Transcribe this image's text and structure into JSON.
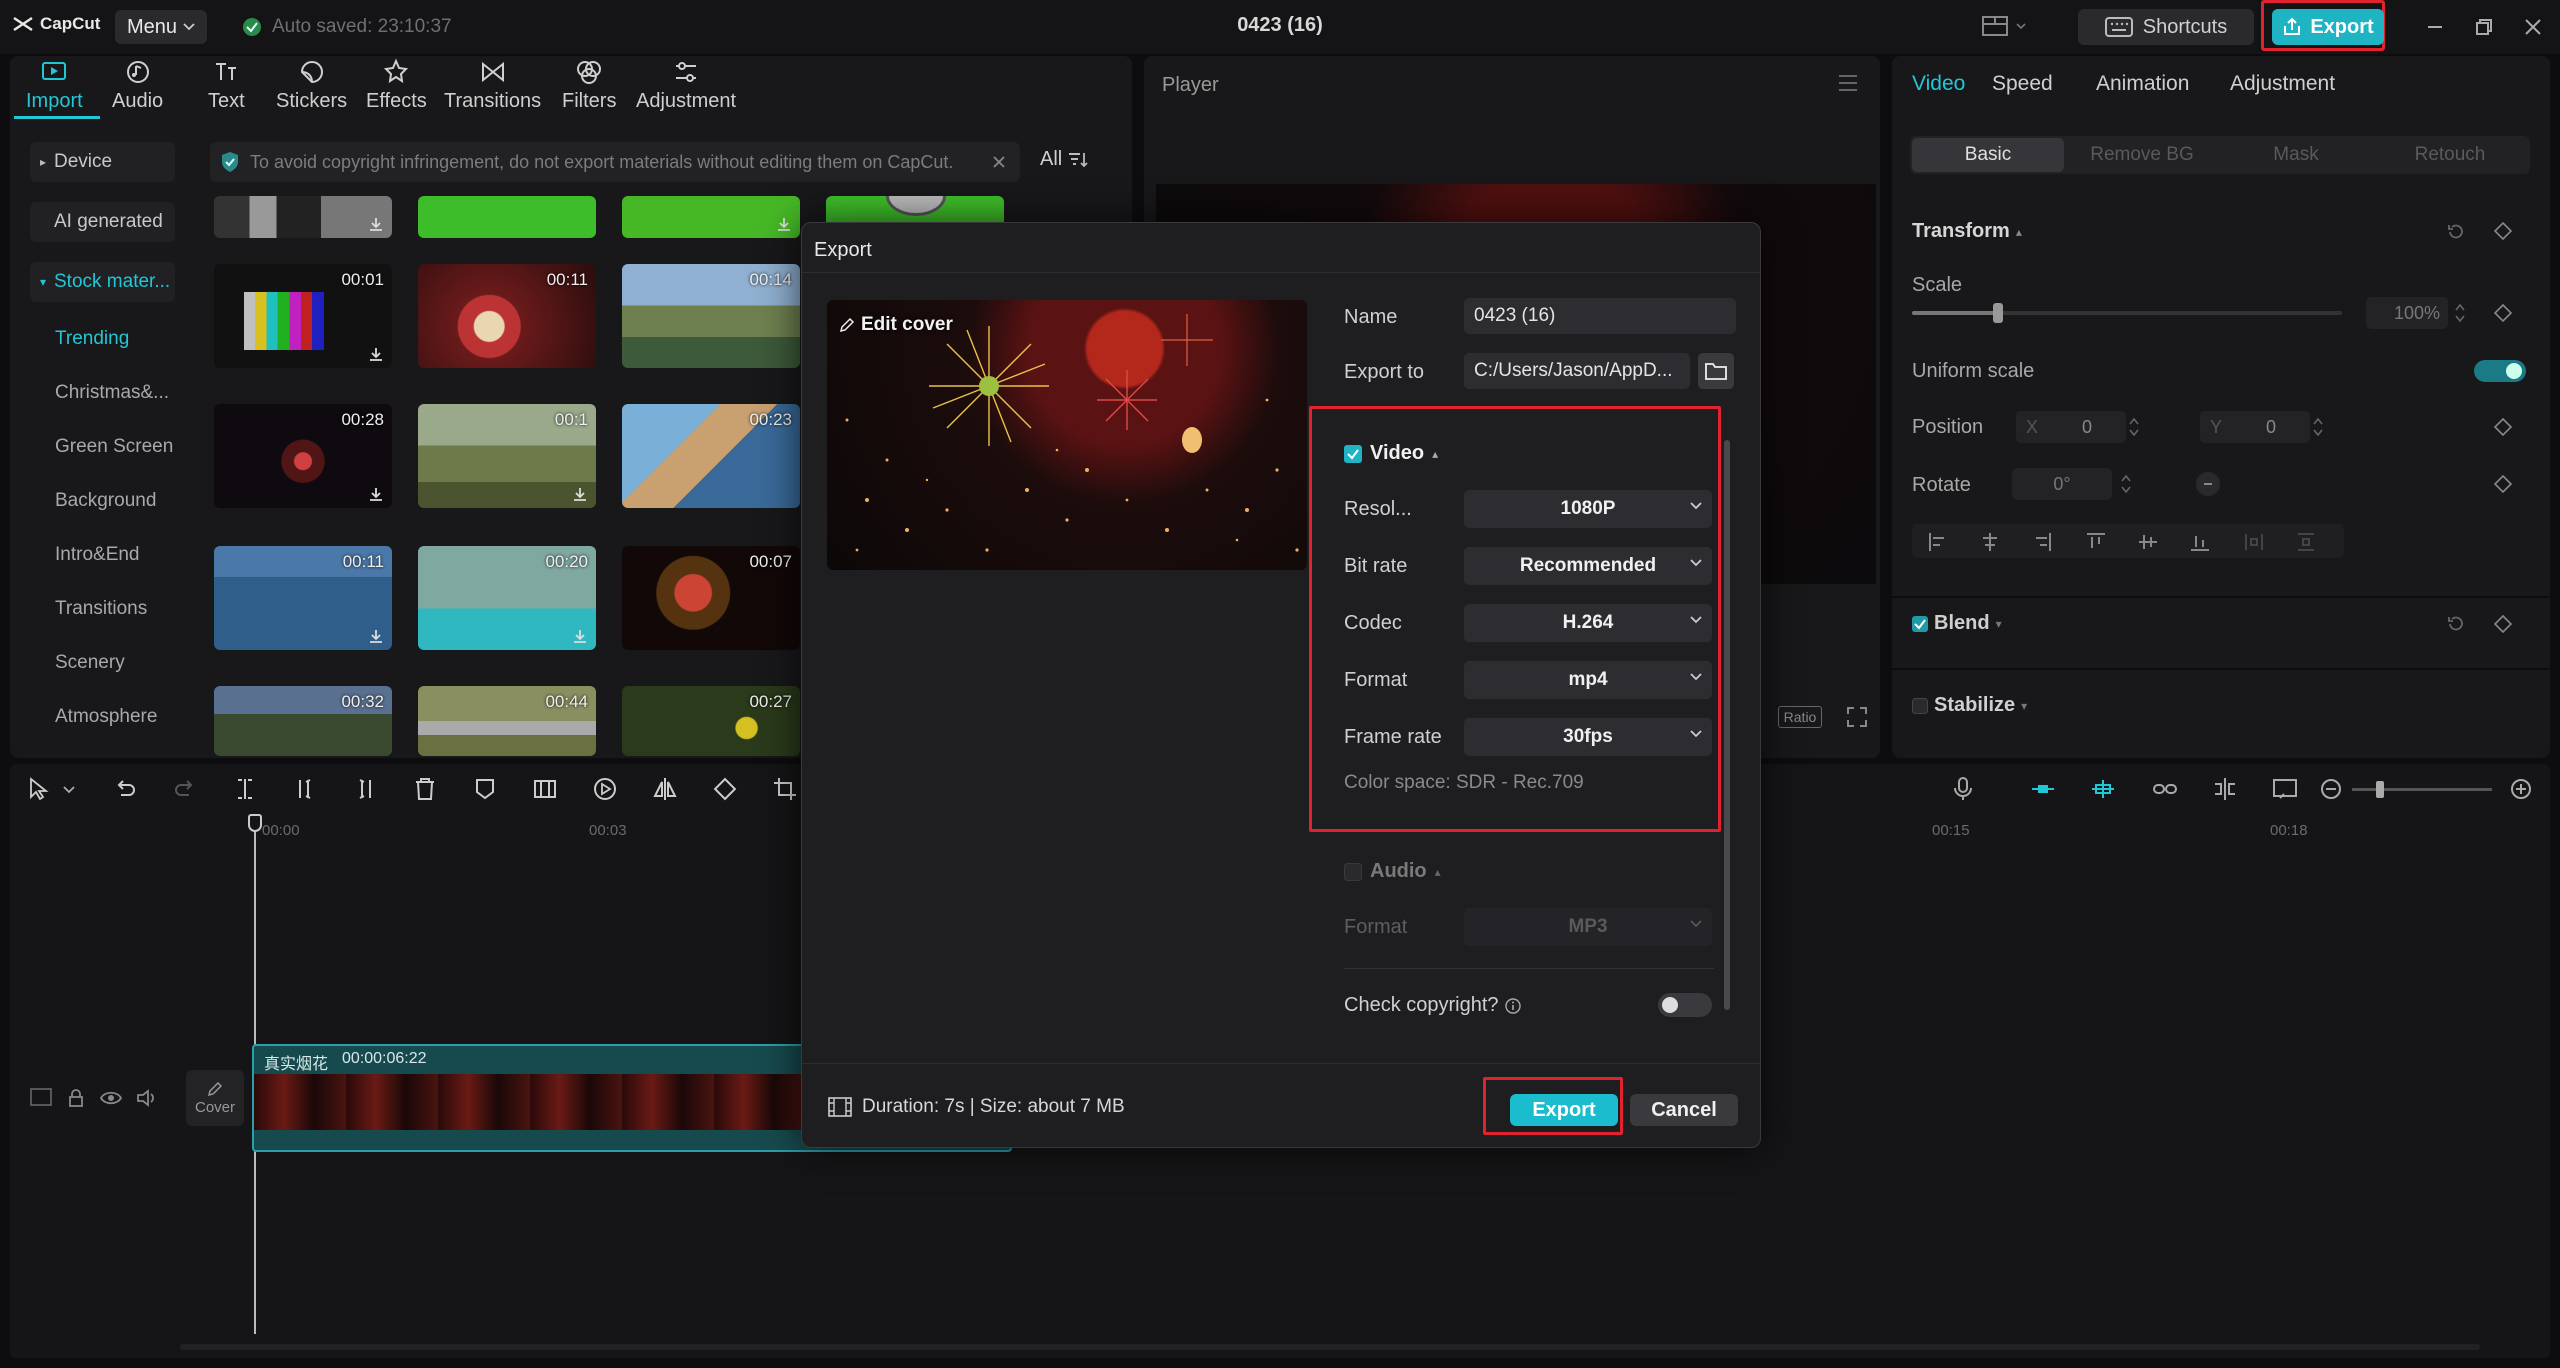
{
  "app": {
    "logo_text": "CapCut",
    "menu_label": "Menu",
    "autosave": "Auto saved: 23:10:37",
    "project_title": "0423 (16)",
    "shortcuts_label": "Shortcuts",
    "export_label": "Export"
  },
  "toolbar": {
    "items": [
      {
        "label": "Import",
        "icon": "import-icon",
        "active": true
      },
      {
        "label": "Audio",
        "icon": "audio-icon"
      },
      {
        "label": "Text",
        "icon": "text-icon"
      },
      {
        "label": "Stickers",
        "icon": "stickers-icon"
      },
      {
        "label": "Effects",
        "icon": "effects-icon"
      },
      {
        "label": "Transitions",
        "icon": "transitions-icon"
      },
      {
        "label": "Filters",
        "icon": "filters-icon"
      },
      {
        "label": "Adjustment",
        "icon": "adjustment-icon"
      }
    ]
  },
  "sidebar": {
    "device": "Device",
    "ai_generated": "AI generated",
    "stock": "Stock mater...",
    "categories": [
      "Trending",
      "Christmas&...",
      "Green Screen",
      "Background",
      "Intro&End",
      "Transitions",
      "Scenery",
      "Atmosphere"
    ]
  },
  "media": {
    "notice": "To avoid copyright infringement, do not export materials without editing them on CapCut.",
    "filter_label": "All",
    "durations": [
      "00:01",
      "00:11",
      "00:14",
      "00:28",
      "00:1",
      "00:23",
      "00:11",
      "00:20",
      "00:07",
      "00:32",
      "00:44",
      "00:27"
    ]
  },
  "player": {
    "title": "Player",
    "ratio_label": "Ratio"
  },
  "right_panel": {
    "tabs": [
      "Video",
      "Speed",
      "Animation",
      "Adjustment"
    ],
    "subtabs": [
      "Basic",
      "Remove BG",
      "Mask",
      "Retouch"
    ],
    "transform": "Transform",
    "scale": "Scale",
    "scale_value": "100%",
    "scale_fraction": 0.2,
    "uniform_scale": "Uniform scale",
    "position": "Position",
    "pos_x_label": "X",
    "pos_x": "0",
    "pos_y_label": "Y",
    "pos_y": "0",
    "rotate": "Rotate",
    "rotate_value": "0°",
    "blend": "Blend",
    "stabilize": "Stabilize"
  },
  "timeline": {
    "ticks": [
      "00:00",
      "00:03",
      "00:15",
      "00:18"
    ],
    "clip_title": "真实烟花",
    "clip_duration": "00:00:06:22",
    "cover_label": "Cover"
  },
  "dialog": {
    "title": "Export",
    "edit_cover": "Edit cover",
    "name_label": "Name",
    "name_value": "0423 (16)",
    "export_to_label": "Export to",
    "export_to_value": "C:/Users/Jason/AppD...",
    "video_label": "Video",
    "rows": [
      {
        "label": "Resol...",
        "value": "1080P"
      },
      {
        "label": "Bit rate",
        "value": "Recommended"
      },
      {
        "label": "Codec",
        "value": "H.264"
      },
      {
        "label": "Format",
        "value": "mp4"
      },
      {
        "label": "Frame rate",
        "value": "30fps"
      }
    ],
    "color_space": "Color space: SDR - Rec.709",
    "audio_label": "Audio",
    "audio_format_label": "Format",
    "audio_format_value": "MP3",
    "check_copyright": "Check copyright?",
    "footer_info": "Duration: 7s | Size: about 7 MB",
    "export_btn": "Export",
    "cancel_btn": "Cancel"
  },
  "colors": {
    "accent": "#22c7d6",
    "highlight": "#e0232e",
    "background": "#0d0d0f"
  }
}
